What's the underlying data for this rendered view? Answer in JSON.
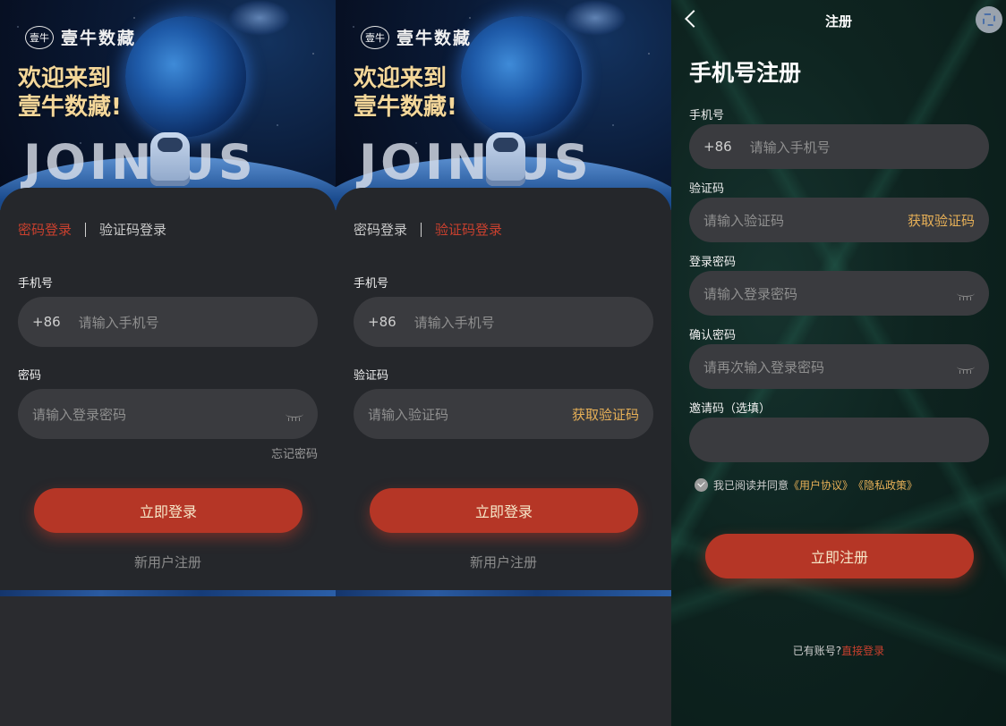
{
  "screens": {
    "password_login": {
      "logo": "壹牛数藏",
      "logo_mark": "壹牛",
      "welcome_line1": "欢迎来到",
      "welcome_line2": "壹牛数藏!",
      "banner_text": "JOIN US",
      "tab_password": "密码登录",
      "tab_code": "验证码登录",
      "phone_label": "手机号",
      "phone_prefix": "+86",
      "phone_placeholder": "请输入手机号",
      "password_label": "密码",
      "password_placeholder": "请输入登录密码",
      "forgot": "忘记密码",
      "login_button": "立即登录",
      "register_link": "新用户注册"
    },
    "code_login": {
      "logo": "壹牛数藏",
      "logo_mark": "壹牛",
      "welcome_line1": "欢迎来到",
      "welcome_line2": "壹牛数藏!",
      "banner_text": "JOIN US",
      "tab_password": "密码登录",
      "tab_code": "验证码登录",
      "phone_label": "手机号",
      "phone_prefix": "+86",
      "phone_placeholder": "请输入手机号",
      "code_label": "验证码",
      "code_placeholder": "请输入验证码",
      "get_code": "获取验证码",
      "login_button": "立即登录",
      "register_link": "新用户注册"
    },
    "register": {
      "nav_title": "注册",
      "heading": "手机号注册",
      "phone_label": "手机号",
      "phone_prefix": "+86",
      "phone_placeholder": "请输入手机号",
      "code_label": "验证码",
      "code_placeholder": "请输入验证码",
      "get_code": "获取验证码",
      "password_label": "登录密码",
      "password_placeholder": "请输入登录密码",
      "confirm_label": "确认密码",
      "confirm_placeholder": "请再次输入登录密码",
      "invite_label": "邀请码（选填）",
      "invite_value": "",
      "agree_text": "我已阅读并同意",
      "user_agreement": "《用户协议》",
      "privacy_policy": "《隐私政策》",
      "register_button": "立即注册",
      "have_account": "已有账号?",
      "login_now": "直接登录"
    }
  },
  "colors": {
    "accent_red": "#b53626",
    "active_tab": "#c9402e",
    "gold": "#e7b057",
    "background": "#25272b",
    "field": "#3a3b3f"
  }
}
